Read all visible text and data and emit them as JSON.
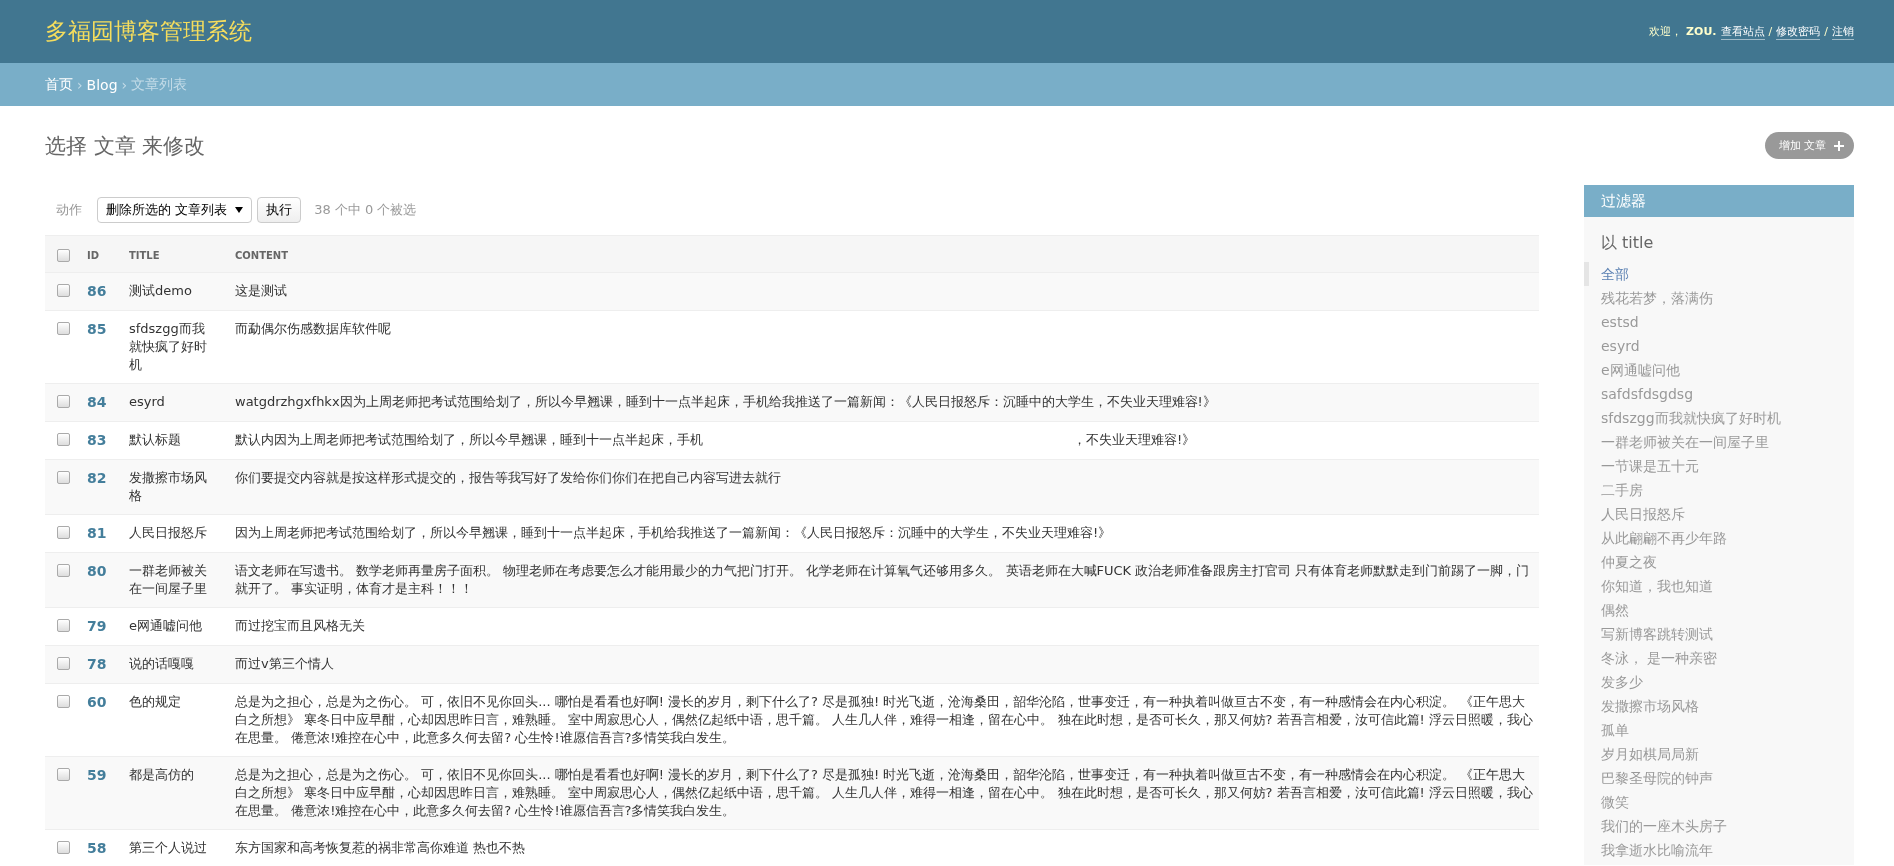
{
  "header": {
    "site_title": "多福园博客管理系统",
    "user_tools": [
      {
        "kind": "text",
        "text": "欢迎，"
      },
      {
        "kind": "user",
        "text": "ZOU."
      },
      {
        "kind": "link",
        "text": "查看站点"
      },
      {
        "kind": "sep",
        "text": "/"
      },
      {
        "kind": "link",
        "text": "修改密码"
      },
      {
        "kind": "sep",
        "text": "/"
      },
      {
        "kind": "link",
        "text": "注销"
      }
    ]
  },
  "breadcrumbs": [
    {
      "kind": "link",
      "text": "首页"
    },
    {
      "kind": "sep",
      "text": "›"
    },
    {
      "kind": "link",
      "text": "Blog"
    },
    {
      "kind": "sep",
      "text": "›"
    },
    {
      "kind": "current",
      "text": "文章列表"
    }
  ],
  "page_title": "选择 文章 来修改",
  "add_button": {
    "label": "增加 文章"
  },
  "actions": {
    "label": "动作",
    "select_value": "删除所选的 文章列表",
    "run_button": "执行",
    "counter": "38 个中 0 个被选"
  },
  "table": {
    "select_all": {
      "checked": false
    },
    "columns": [
      "ID",
      "TITLE",
      "CONTENT"
    ],
    "rows": [
      {
        "id": "86",
        "title": "测试demo",
        "content": [
          "这是测试"
        ],
        "checked": false
      },
      {
        "id": "85",
        "title": "sfdszgg而我就快疯了好时机",
        "content": [
          "而勐偶尔伤感数据库软件呢"
        ],
        "checked": false
      },
      {
        "id": "84",
        "title": "esyrd",
        "content": [
          "watgdrzhgxfhkx因为上周老师把考试范围给划了，所以今早翘课，睡到十一点半起床，手机给我推送了一篇新闻：《人民日报怒斥：沉睡中的大学生，不失业天理难容!》"
        ],
        "checked": false
      },
      {
        "id": "83",
        "title": "默认标题",
        "content": [
          "默认内因为上周老师把考试范围给划了，所以今早翘课，睡到十一点半起床，手机",
          "，不失业天理难容!》"
        ],
        "checked": false
      },
      {
        "id": "82",
        "title": "发撒擦市场风格",
        "content": [
          "你们要提交内容就是按这样形式提交的，报告等我写好了发给你们你们在把自己内容写进去就行"
        ],
        "checked": false
      },
      {
        "id": "81",
        "title": "人民日报怒斥",
        "content": [
          "因为上周老师把考试范围给划了，所以今早翘课，睡到十一点半起床，手机给我推送了一篇新闻：《人民日报怒斥：沉睡中的大学生，不失业天理难容!》"
        ],
        "checked": false
      },
      {
        "id": "80",
        "title": "一群老师被关在一间屋子里",
        "content": [
          "语文老师在写遗书。 数学老师再量房子面积。 物理老师在考虑要怎么才能用最少的力气把门打开。 化学老师在计算氧气还够用多久。 英语老师在大喊FUCK 政治老师准备跟房主打官司 只有体育老师默默走到门前踢了一脚，门就开了。 事实证明，体育才是主科！！！"
        ],
        "checked": false
      },
      {
        "id": "79",
        "title": "e网通嘘问他",
        "content": [
          "而过挖宝而且风格无关"
        ],
        "checked": false
      },
      {
        "id": "78",
        "title": "说的话嘎嘎",
        "content": [
          "而过v第三个情人"
        ],
        "checked": false
      },
      {
        "id": "60",
        "title": "色的规定",
        "content": [
          "总是为之担心，总是为之伤心。 可，依旧不见你回头... 哪怕是看看也好啊! 漫长的岁月，剩下什么了? 尽是孤独! 时光飞逝，沧海桑田，韶华沦陷，世事变迁，有一种执着叫做亘古不变，有一种感情会在内心积淀。 《正午思大白之所想》 寒冬日中应早酣，心却因思昨日言，难熟睡。 室中周寂思心人，偶然亿起纸中语，思千篇。 人生几人伴，难得一相逢，留在心中。 独在此时想，是否可长久，那又何妨? 若吾言相爱，汝可信此篇! 浮云日照暖，我心在思量。 倦意浓!难控在心中，此意多久何去留? 心生怜!谁愿信吾言?多情笑我白发生。"
        ],
        "checked": false
      },
      {
        "id": "59",
        "title": "都是高仿的",
        "content": [
          "总是为之担心，总是为之伤心。 可，依旧不见你回头... 哪怕是看看也好啊! 漫长的岁月，剩下什么了? 尽是孤独! 时光飞逝，沧海桑田，韶华沦陷，世事变迁，有一种执着叫做亘古不变，有一种感情会在内心积淀。 《正午思大白之所想》 寒冬日中应早酣，心却因思昨日言，难熟睡。 室中周寂思心人，偶然亿起纸中语，思千篇。 人生几人伴，难得一相逢，留在心中。 独在此时想，是否可长久，那又何妨? 若吾言相爱，汝可信此篇! 浮云日照暖，我心在思量。 倦意浓!难控在心中，此意多久何去留? 心生怜!谁愿信吾言?多情笑我白发生。"
        ],
        "checked": false
      },
      {
        "id": "58",
        "title": "第三个人说过",
        "content": [
          "东方国家和高考恢复惹的祸非常高你难道 热也不热"
        ],
        "checked": false
      }
    ]
  },
  "filter": {
    "heading": "过滤器",
    "subheading": "以 title",
    "items": [
      {
        "label": "全部",
        "selected": true
      },
      {
        "label": "残花若梦，落满伤",
        "selected": false
      },
      {
        "label": "estsd",
        "selected": false
      },
      {
        "label": "esyrd",
        "selected": false
      },
      {
        "label": "e网通嘘问他",
        "selected": false
      },
      {
        "label": "safdsfdsgdsg",
        "selected": false
      },
      {
        "label": "sfdszgg而我就快疯了好时机",
        "selected": false
      },
      {
        "label": "一群老师被关在一间屋子里",
        "selected": false
      },
      {
        "label": "一节课是五十元",
        "selected": false
      },
      {
        "label": "二手房",
        "selected": false
      },
      {
        "label": "人民日报怒斥",
        "selected": false
      },
      {
        "label": "从此翩翩不再少年路",
        "selected": false
      },
      {
        "label": "仲夏之夜",
        "selected": false
      },
      {
        "label": "你知道，我也知道",
        "selected": false
      },
      {
        "label": "偶然",
        "selected": false
      },
      {
        "label": "写新博客跳转测试",
        "selected": false
      },
      {
        "label": "冬泳， 是一种亲密",
        "selected": false
      },
      {
        "label": "发多少",
        "selected": false
      },
      {
        "label": "发撒擦市场风格",
        "selected": false
      },
      {
        "label": "孤单",
        "selected": false
      },
      {
        "label": "岁月如棋局局新",
        "selected": false
      },
      {
        "label": "巴黎圣母院的钟声",
        "selected": false
      },
      {
        "label": "微笑",
        "selected": false
      },
      {
        "label": "我们的一座木头房子",
        "selected": false
      },
      {
        "label": "我拿逝水比喻流年",
        "selected": false
      }
    ]
  }
}
